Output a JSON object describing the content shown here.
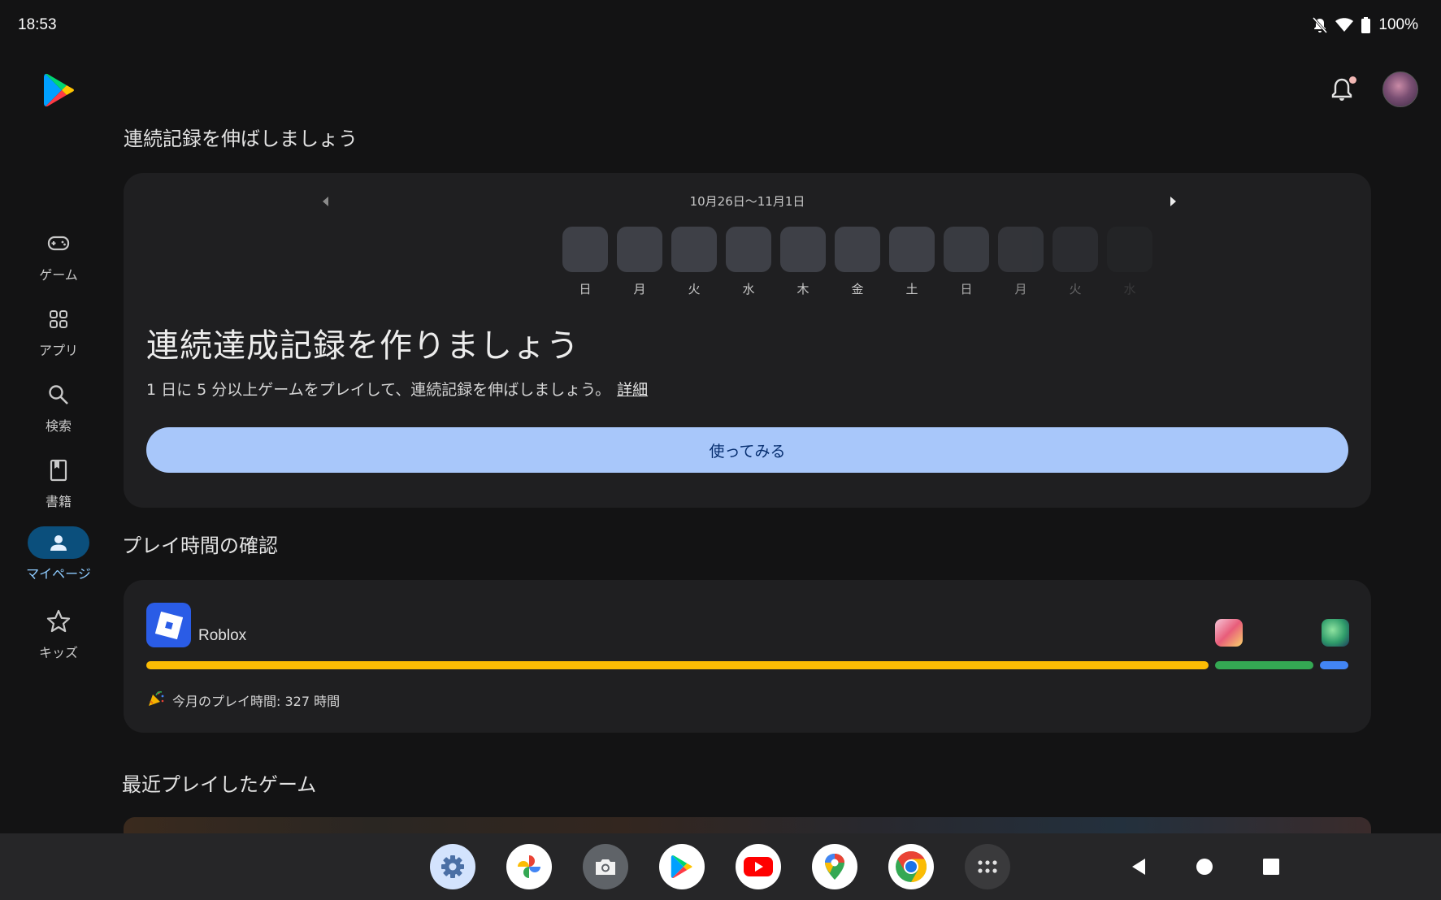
{
  "status_bar": {
    "time": "18:53",
    "battery": "100%",
    "icons": [
      "notifications-off-icon",
      "wifi-icon",
      "battery-icon"
    ]
  },
  "nav_rail": {
    "items": [
      {
        "label": "ゲーム",
        "icon": "gamepad-icon",
        "active": false
      },
      {
        "label": "アプリ",
        "icon": "apps-grid-icon",
        "active": false
      },
      {
        "label": "検索",
        "icon": "search-icon",
        "active": false
      },
      {
        "label": "書籍",
        "icon": "book-icon",
        "active": false
      },
      {
        "label": "マイページ",
        "icon": "person-icon",
        "active": true
      },
      {
        "label": "キッズ",
        "icon": "star-icon",
        "active": false
      }
    ]
  },
  "header": {
    "notification_icon": "bell-icon",
    "avatar_icon": "avatar-icon"
  },
  "streak": {
    "section_title": "連続記録を伸ばしましょう",
    "week_range": "10月26日〜11月1日",
    "days": [
      "日",
      "月",
      "火",
      "水",
      "木",
      "金",
      "土",
      "日",
      "月",
      "火",
      "水"
    ],
    "title": "連続達成記録を作りましょう",
    "description": "1 日に 5 分以上ゲームをプレイして、連続記録を伸ばしましょう。",
    "details_link": "詳細",
    "try_button": "使ってみる"
  },
  "playtime": {
    "section_title": "プレイ時間の確認",
    "game_name": "Roblox",
    "monthly_playtime": "今月のプレイ時間: 327 時間",
    "colors": {
      "roblox": "#fbbc04",
      "game2": "#34a853",
      "game3": "#4285f4"
    }
  },
  "recent": {
    "section_title": "最近プレイしたゲーム"
  },
  "dock": {
    "apps": [
      "settings-icon",
      "photos-icon",
      "camera-icon",
      "play-store-icon",
      "youtube-icon",
      "maps-icon",
      "chrome-icon",
      "app-drawer-icon"
    ],
    "nav": [
      "back-icon",
      "home-icon",
      "recents-icon"
    ]
  }
}
